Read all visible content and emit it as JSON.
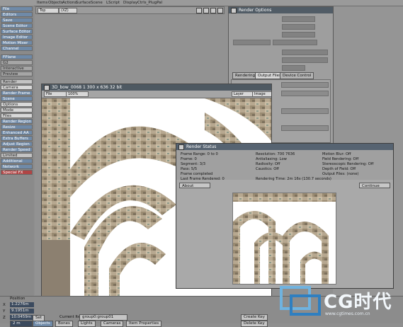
{
  "topbar": {
    "tabs": [
      "Items",
      "Objects",
      "Actions",
      "Surface",
      "Scene",
      "LScript",
      "Display",
      "Ctrls_PlugPal"
    ]
  },
  "sidebar": {
    "items": [
      {
        "label": "File",
        "style": "blue"
      },
      {
        "label": "Editors",
        "style": "blue"
      },
      {
        "label": "Save",
        "style": "blue"
      },
      {
        "label": "Scene Editor",
        "style": "blue"
      },
      {
        "label": "Surface Editor",
        "style": "blue"
      },
      {
        "label": "Image Editor",
        "style": "blue"
      },
      {
        "label": "Motion Mixer",
        "style": "blue"
      },
      {
        "label": "Channel",
        "style": "blue"
      },
      {
        "label": "FPlane",
        "style": "blue"
      },
      {
        "label": "G2",
        "style": "gray"
      },
      {
        "label": "Interactive",
        "style": "gray"
      },
      {
        "label": "Preview",
        "style": "gray"
      },
      {
        "label": "Render",
        "style": "light"
      },
      {
        "label": "Camera",
        "style": "white"
      },
      {
        "label": "Render Frame",
        "style": "blue"
      },
      {
        "label": "Scene",
        "style": "blue"
      },
      {
        "label": "Options",
        "style": "white"
      },
      {
        "label": "Mode",
        "style": "white"
      },
      {
        "label": "Files",
        "style": "white"
      },
      {
        "label": "Render Region",
        "style": "blue"
      },
      {
        "label": "Resize",
        "style": "blue"
      },
      {
        "label": "Enhanced AA",
        "style": "blue"
      },
      {
        "label": "Extra Buffers",
        "style": "blue"
      },
      {
        "label": "Adjust Region",
        "style": "blue"
      },
      {
        "label": "Render Speed",
        "style": "blue"
      },
      {
        "label": "Limited",
        "style": "light"
      },
      {
        "label": "Additional",
        "style": "blue"
      },
      {
        "label": "Network",
        "style": "blue"
      },
      {
        "label": "Special FX",
        "style": "red"
      }
    ]
  },
  "viewport": {
    "view_mode": "Top",
    "layer": "(XZ)"
  },
  "render_options": {
    "title": "Render Options",
    "tabs": [
      "Rendering",
      "Output Files",
      "Device Control"
    ]
  },
  "viewer": {
    "title": "3D_bow_0068 1   300 x 636 32 bit",
    "file_menu": "File",
    "zoom": "100%",
    "layer_menu": "Layer",
    "image_menu": "Image"
  },
  "render_status": {
    "title": "Render Status",
    "left_lines": [
      "Frame Range: 0 to 0",
      "Frame: 0",
      "Segment: 3/3",
      "Pass: 5/5",
      "Frame completed",
      "Last Frame Rendered: 0"
    ],
    "mid_lines": [
      "Resolution: 700 7636",
      "Antialiasing: Low",
      "Radiosity: Off",
      "Caustics: Off"
    ],
    "right_lines": [
      "Motion Blur: Off",
      "Field Rendering: Off",
      "Stereoscopic Rendering: Off",
      "Depth of Field: Off",
      "Output Files: (none)"
    ],
    "render_time": "Rendering Time: 2m 16s (130.7 seconds)",
    "about_label": "About",
    "continue_label": "Continue"
  },
  "bottombar": {
    "position_label": "Position",
    "x_label": "X",
    "x_value": "1.2276m",
    "y_label": "Y",
    "y_value": "9.1951m",
    "z_label": "Z",
    "z_value": "10.0459m",
    "grid_value": "2 m",
    "current_item_label": "Current Item",
    "current_item_value": "group0:group01",
    "set_label": "Set",
    "create_key": "Create Key",
    "delete_key": "Delete Key",
    "objects_tab": "Objects",
    "bones_tab": "Bones",
    "lights_tab": "Lights",
    "cameras_tab": "Cameras",
    "properties": "Item Properties"
  },
  "watermark": {
    "brand": "CG时代",
    "url": "www.cgtimes.com.cn"
  }
}
